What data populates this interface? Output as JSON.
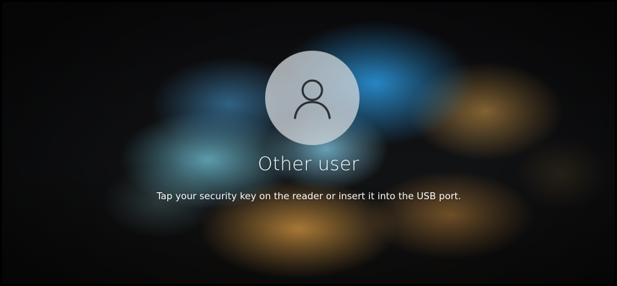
{
  "user": {
    "name": "Other user",
    "avatar_icon": "user-silhouette-icon"
  },
  "message": {
    "text": "Tap your security key on the reader or insert it into the USB port."
  },
  "colors": {
    "text": "#ffffff",
    "avatar_bg": "#c8cfd3",
    "avatar_icon": "#2b2f33"
  }
}
